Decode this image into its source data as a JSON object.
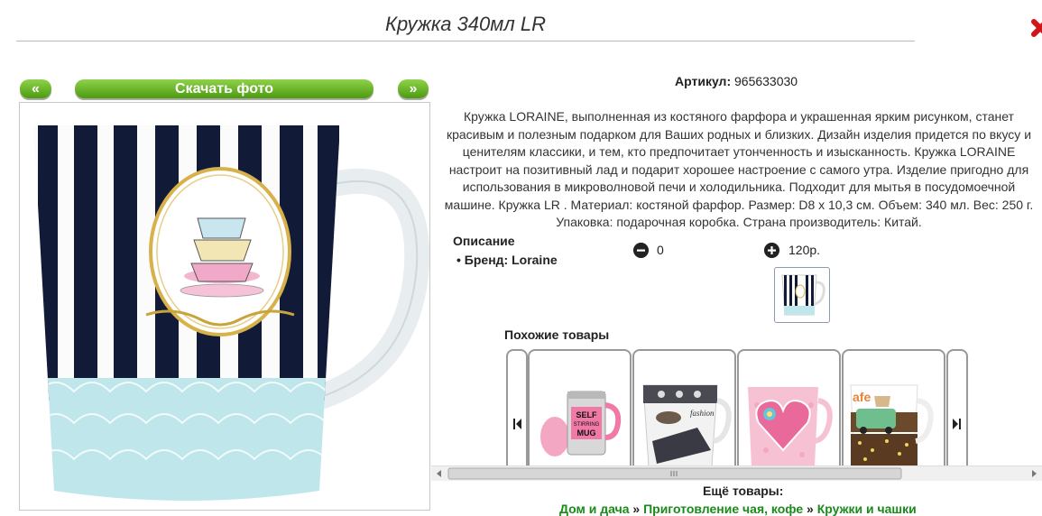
{
  "product": {
    "title": "Кружка 340мл LR",
    "article_label": "Артикул:",
    "article_value": "965633030",
    "description": "Кружка LORAINE, выполненная из костяного фарфора и украшенная ярким рисунком, станет красивым и полезным подарком для Ваших родных и близких. Дизайн изделия придется по вкусу и ценителям классики, и тем, кто предпочитает утонченность и изысканность. Кружка LORAINE настроит на позитивный лад и подарит хорошее настроение с самого утра. Изделие пригодно для использования в микроволновой печи и холодильника. Подходит для мытья в посудомоечной машине. Кружка LR . Материал: костяной фарфор. Размер: D8 x 10,3 см. Объем: 340 мл. Вес: 250 г. Упаковка: подарочная коробка. Страна производитель: Китай.",
    "description_heading": "Описание",
    "brand_line": "Бренд: Loraine",
    "quantity": "0",
    "price": "120р."
  },
  "photo_nav": {
    "prev_label": "«",
    "download_label": "Скачать фото",
    "next_label": "»"
  },
  "similar": {
    "heading": "Похожие товары",
    "cards": [
      {
        "name": "self-stirring-mug",
        "text": "SELF STIRRING MUG"
      },
      {
        "name": "fashion-mug",
        "text": "fashion"
      },
      {
        "name": "heart-mug",
        "text": ""
      },
      {
        "name": "cafe-car-mug",
        "text": "afe"
      }
    ]
  },
  "more": {
    "heading": "Ещё товары:",
    "crumbs": [
      "Дом и дача",
      "Приготовление чая, кофе",
      "Кружки и чашки"
    ],
    "separator": "»"
  },
  "colors": {
    "accent_green": "#5fb021",
    "link_green": "#1a8a1a",
    "close_red": "#d0151b"
  }
}
